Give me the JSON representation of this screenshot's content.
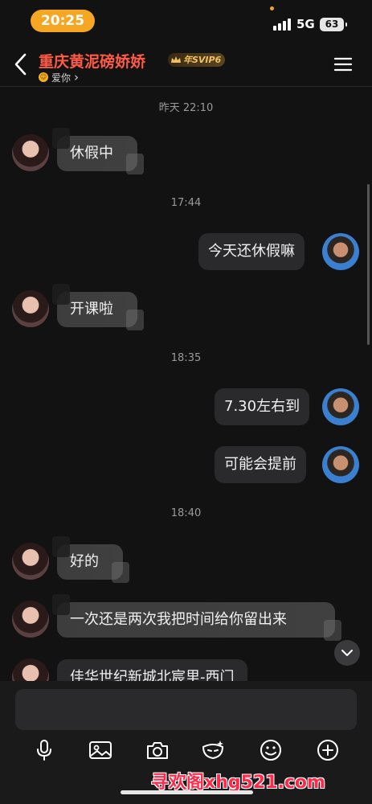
{
  "status_bar": {
    "time": "20:25",
    "network": "5G",
    "battery": "63"
  },
  "header": {
    "contact_name": "重庆黄泥磅娇娇",
    "vip_badge": "年SVIP6",
    "status_text": "爱你",
    "status_chevron": "›"
  },
  "messages": {
    "ts1": "昨天 22:10",
    "m1": "休假中",
    "ts2": "17:44",
    "m2": "今天还休假嘛",
    "m3": "开课啦",
    "ts3": "18:35",
    "m4": "7.30左右到",
    "m5": "可能会提前",
    "ts4": "18:40",
    "m6": "好的",
    "m7": "一次还是两次我把时间给你留出来",
    "m8": "佳华世纪新城北宸里-西门"
  },
  "input": {
    "placeholder": ""
  },
  "watermark": "寻欢阁xhg521.com",
  "colors": {
    "accent": "#f5a623",
    "name_red": "#ff5a45",
    "bg": "#121212",
    "bubble": "#2a2a2c"
  }
}
